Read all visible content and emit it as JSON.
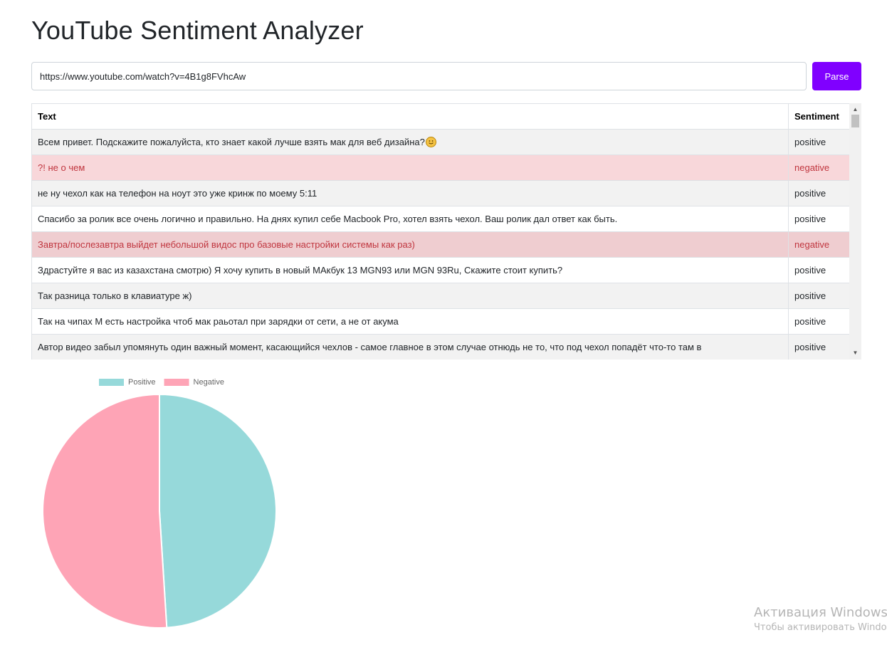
{
  "app": {
    "title": "YouTube Sentiment Analyzer"
  },
  "search": {
    "url_value": "https://www.youtube.com/watch?v=4B1g8FVhcAw",
    "parse_label": "Parse"
  },
  "table": {
    "headers": [
      "Text",
      "Sentiment"
    ],
    "rows": [
      {
        "text": "Всем привет. Подскажите пожалуйста, кто знает какой лучше взять мак для веб дизайна?",
        "sentiment": "positive",
        "emoji": "smiling-face-emoji"
      },
      {
        "text": "?! не о чем",
        "sentiment": "negative"
      },
      {
        "text": "не ну чехол как на телефон на ноут это уже кринж по моему 5:11",
        "sentiment": "positive"
      },
      {
        "text": "Спасибо за ролик все очень логично и правильно. На днях купил себе Macbook Pro, хотел взять чехол. Ваш ролик дал ответ как быть.",
        "sentiment": "positive"
      },
      {
        "text": "Завтра/послезавтра выйдет небольшой видос про базовые настройки системы как раз)",
        "sentiment": "negative"
      },
      {
        "text": "Здрастуйте я вас из казахстана смотрю) Я хочу купить в новый МАкбук 13 MGN93 или MGN 93Ru, Скажите стоит купить?",
        "sentiment": "positive"
      },
      {
        "text": "Так разница только в клавиатуре ж)",
        "sentiment": "positive"
      },
      {
        "text": "Так на чипах М есть настройка чтоб мак раьотал при зарядки от сети, а не от акума",
        "sentiment": "positive"
      },
      {
        "text": "Автор видео забыл упомянуть один важный момент, касающийся чехлов - самое главное в этом случае отнюдь не то, что под чехол попадёт что-то там в",
        "sentiment": "positive"
      }
    ]
  },
  "chart_data": {
    "type": "pie",
    "title": "",
    "legend": [
      "Positive",
      "Negative"
    ],
    "legend_position": "top",
    "series": [
      {
        "name": "Positive",
        "value": 49,
        "color": "#96d9da"
      },
      {
        "name": "Negative",
        "value": 51,
        "color": "#fea4b6"
      }
    ]
  },
  "colors": {
    "accent": "#8000ff",
    "negative_row_bg": "#f8d7da",
    "negative_text": "#c0363f",
    "stripe_bg": "#f2f2f2"
  },
  "watermark": {
    "title": "Активация Windows",
    "subtitle": "Чтобы активировать Windows"
  }
}
